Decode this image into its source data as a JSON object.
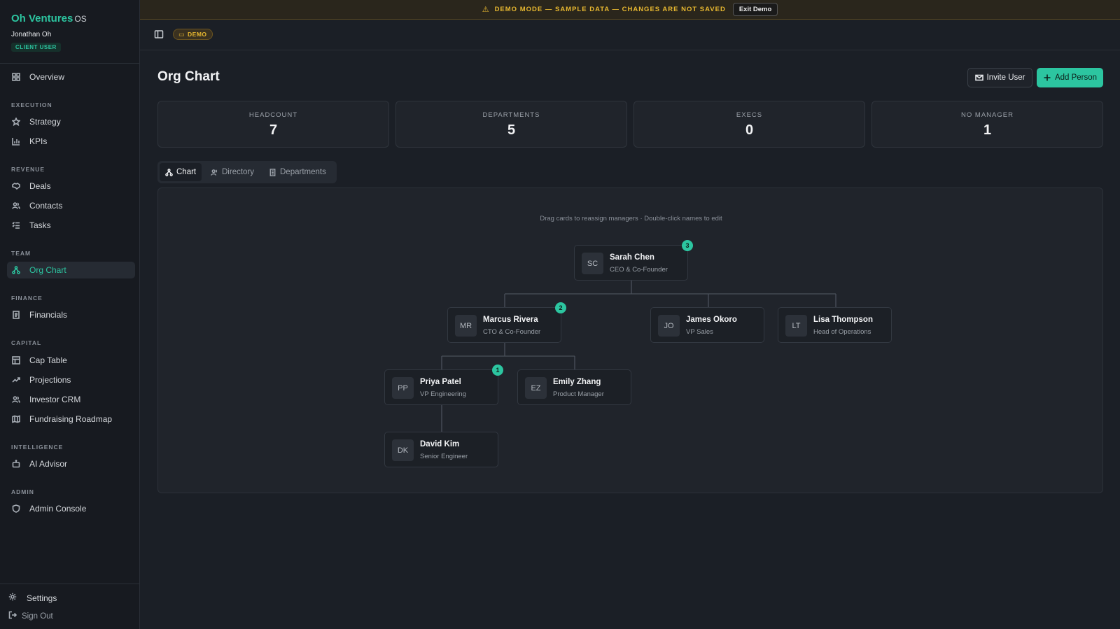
{
  "sidebar": {
    "brand": "Oh Ventures",
    "brand_suffix": "OS",
    "user": "Jonathan Oh",
    "role": "CLIENT USER",
    "overview": "Overview",
    "sections": {
      "execution": "EXECUTION",
      "revenue": "REVENUE",
      "team": "TEAM",
      "finance": "FINANCE",
      "capital": "CAPITAL",
      "intelligence": "INTELLIGENCE",
      "admin": "ADMIN"
    },
    "items": {
      "strategy": "Strategy",
      "kpis": "KPIs",
      "deals": "Deals",
      "contacts": "Contacts",
      "tasks": "Tasks",
      "org_chart": "Org Chart",
      "financials": "Financials",
      "cap_table": "Cap Table",
      "projections": "Projections",
      "investor_crm": "Investor CRM",
      "fundraising_roadmap": "Fundraising Roadmap",
      "ai_advisor": "AI Advisor",
      "admin_console": "Admin Console"
    },
    "settings": "Settings",
    "sign_out": "Sign Out"
  },
  "banner": {
    "message": "DEMO MODE — SAMPLE DATA — CHANGES ARE NOT SAVED",
    "exit_label": "Exit Demo"
  },
  "topbar": {
    "demo_pill": "DEMO"
  },
  "page": {
    "title": "Org Chart",
    "invite_label": "Invite User",
    "add_label": "Add Person"
  },
  "stats": [
    {
      "label": "HEADCOUNT",
      "value": "7"
    },
    {
      "label": "DEPARTMENTS",
      "value": "5"
    },
    {
      "label": "EXECS",
      "value": "0"
    },
    {
      "label": "NO MANAGER",
      "value": "1"
    }
  ],
  "tabs": {
    "chart": "Chart",
    "directory": "Directory",
    "departments": "Departments"
  },
  "chart": {
    "hint": "Drag cards to reassign managers · Double-click names to edit",
    "people": [
      {
        "initials": "SC",
        "name": "Sarah Chen",
        "title": "CEO & Co-Founder",
        "reports": "3"
      },
      {
        "initials": "MR",
        "name": "Marcus Rivera",
        "title": "CTO & Co-Founder",
        "reports": "2"
      },
      {
        "initials": "JO",
        "name": "James Okoro",
        "title": "VP Sales"
      },
      {
        "initials": "LT",
        "name": "Lisa Thompson",
        "title": "Head of Operations"
      },
      {
        "initials": "PP",
        "name": "Priya Patel",
        "title": "VP Engineering",
        "reports": "1"
      },
      {
        "initials": "EZ",
        "name": "Emily Zhang",
        "title": "Product Manager"
      },
      {
        "initials": "DK",
        "name": "David Kim",
        "title": "Senior Engineer"
      }
    ]
  },
  "colors": {
    "accent": "#2cc5a0",
    "warning": "#e8b830",
    "background": "#1b1f26"
  }
}
